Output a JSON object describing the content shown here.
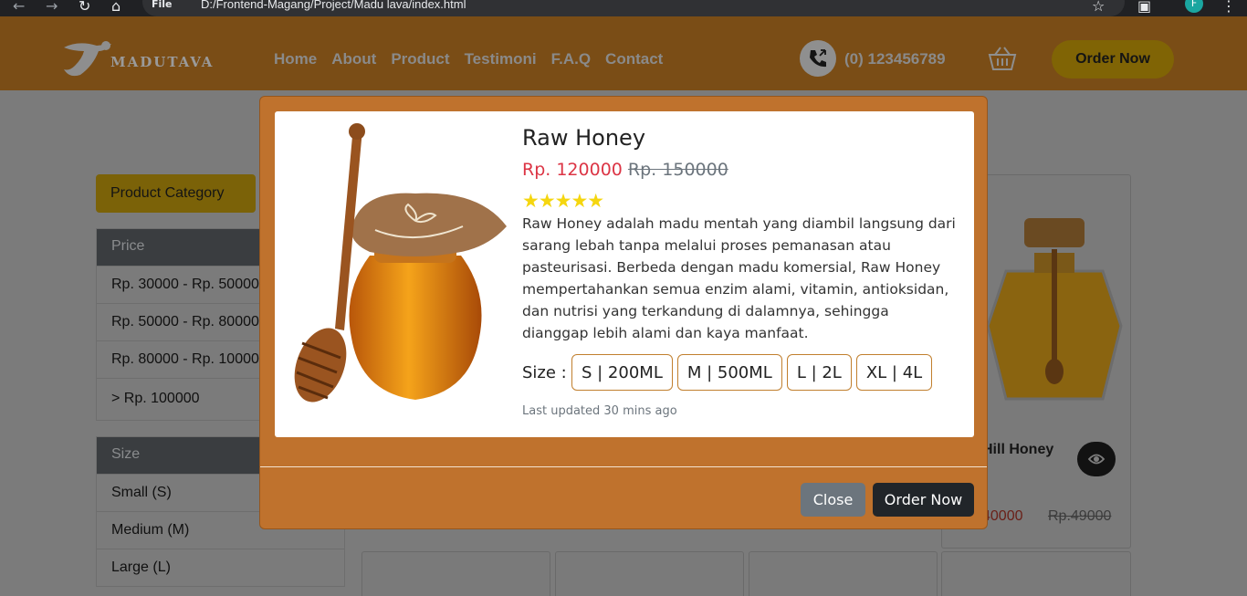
{
  "browser": {
    "url_info": "File",
    "url": "D:/Frontend-Magang/Project/Madu lava/index.html",
    "profile_initial": "F"
  },
  "navbar": {
    "logo_text": "MADUTAVA",
    "links": [
      "Home",
      "About",
      "Product",
      "Testimoni",
      "F.A.Q",
      "Contact"
    ],
    "phone": "(0) 123456789",
    "order_label": "Order Now"
  },
  "sidebar": {
    "category_label": "Product Category",
    "price_heading": "Price",
    "price_items": [
      "Rp. 30000 - Rp. 50000",
      "Rp. 50000 - Rp. 80000",
      "Rp. 80000 - Rp. 100000",
      "> Rp. 100000"
    ],
    "size_heading": "Size",
    "size_items": [
      "Small (S)",
      "Medium (M)",
      "Large (L)"
    ]
  },
  "background_card": {
    "name_fragment": "Hill Honey",
    "price_new_fragment": "40000",
    "price_old": "Rp.49000"
  },
  "modal": {
    "title": "Raw Honey",
    "price_new": "Rp. 120000",
    "price_old": "Rp. 150000",
    "rating": 5,
    "stars": "★★★★★",
    "description": "Raw Honey adalah madu mentah yang diambil langsung dari sarang lebah tanpa melalui proses pemanasan atau pasteurisasi. Berbeda dengan madu komersial, Raw Honey mempertahankan semua enzim alami, vitamin, antioksidan, dan nutrisi yang terkandung di dalamnya, sehingga dianggap lebih alami dan kaya manfaat.",
    "size_label": "Size :",
    "sizes": [
      "S | 200ML",
      "M | 500ML",
      "L | 2L",
      "XL | 4L"
    ],
    "updated": "Last updated 30 mins ago",
    "close_label": "Close",
    "order_label": "Order Now"
  },
  "colors": {
    "modal_bg": "#bf722d",
    "price_new": "#dc3545",
    "star": "#f5d60f",
    "order_button": "#212529",
    "close_button": "#6c757d"
  }
}
